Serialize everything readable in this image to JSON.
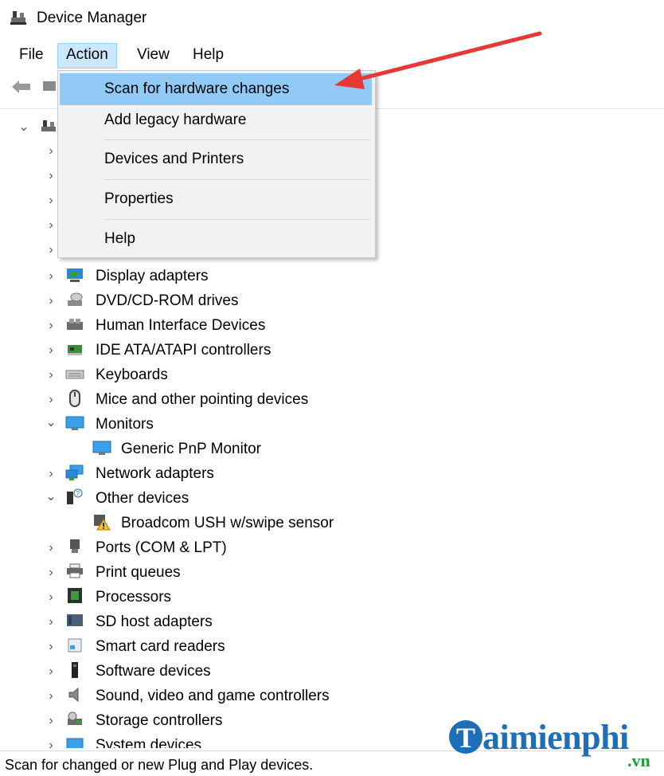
{
  "window": {
    "title": "Device Manager"
  },
  "menubar": {
    "items": [
      {
        "label": "File",
        "active": false
      },
      {
        "label": "Action",
        "active": true
      },
      {
        "label": "View",
        "active": false
      },
      {
        "label": "Help",
        "active": false
      }
    ]
  },
  "action_menu": {
    "items": [
      {
        "label": "Scan for hardware changes",
        "highlighted": true
      },
      {
        "label": "Add legacy hardware",
        "highlighted": false
      },
      {
        "label": "Devices and Printers",
        "highlighted": false
      },
      {
        "label": "Properties",
        "highlighted": false
      },
      {
        "label": "Help",
        "highlighted": false
      }
    ]
  },
  "tree": {
    "items": [
      {
        "label": "Display adapters",
        "expanded": false,
        "icon": "display-adapter-icon"
      },
      {
        "label": "DVD/CD-ROM drives",
        "expanded": false,
        "icon": "dvd-drive-icon"
      },
      {
        "label": "Human Interface Devices",
        "expanded": false,
        "icon": "hid-icon"
      },
      {
        "label": "IDE ATA/ATAPI controllers",
        "expanded": false,
        "icon": "ide-controller-icon"
      },
      {
        "label": "Keyboards",
        "expanded": false,
        "icon": "keyboard-icon"
      },
      {
        "label": "Mice and other pointing devices",
        "expanded": false,
        "icon": "mouse-icon"
      },
      {
        "label": "Monitors",
        "expanded": true,
        "icon": "monitor-icon"
      },
      {
        "label": "Generic PnP Monitor",
        "child": true,
        "icon": "monitor-icon"
      },
      {
        "label": "Network adapters",
        "expanded": false,
        "icon": "network-adapter-icon"
      },
      {
        "label": "Other devices",
        "expanded": true,
        "icon": "other-devices-icon"
      },
      {
        "label": "Broadcom USH w/swipe sensor",
        "child": true,
        "icon": "warning-device-icon"
      },
      {
        "label": "Ports (COM & LPT)",
        "expanded": false,
        "icon": "port-icon"
      },
      {
        "label": "Print queues",
        "expanded": false,
        "icon": "printer-icon"
      },
      {
        "label": "Processors",
        "expanded": false,
        "icon": "processor-icon"
      },
      {
        "label": "SD host adapters",
        "expanded": false,
        "icon": "sd-adapter-icon"
      },
      {
        "label": "Smart card readers",
        "expanded": false,
        "icon": "smart-card-icon"
      },
      {
        "label": "Software devices",
        "expanded": false,
        "icon": "software-device-icon"
      },
      {
        "label": "Sound, video and game controllers",
        "expanded": false,
        "icon": "speaker-icon"
      },
      {
        "label": "Storage controllers",
        "expanded": false,
        "icon": "storage-controller-icon"
      },
      {
        "label": "System devices",
        "expanded": false,
        "icon": "system-device-icon"
      }
    ]
  },
  "statusbar": {
    "text": "Scan for changed or new Plug and Play devices."
  },
  "watermark": {
    "brand": "aimienphi",
    "brand_initial": "T",
    "suffix": ".vn"
  },
  "colors": {
    "highlight": "#91c9f7",
    "accent": "#1e6fb8",
    "arrow": "#e53935"
  }
}
